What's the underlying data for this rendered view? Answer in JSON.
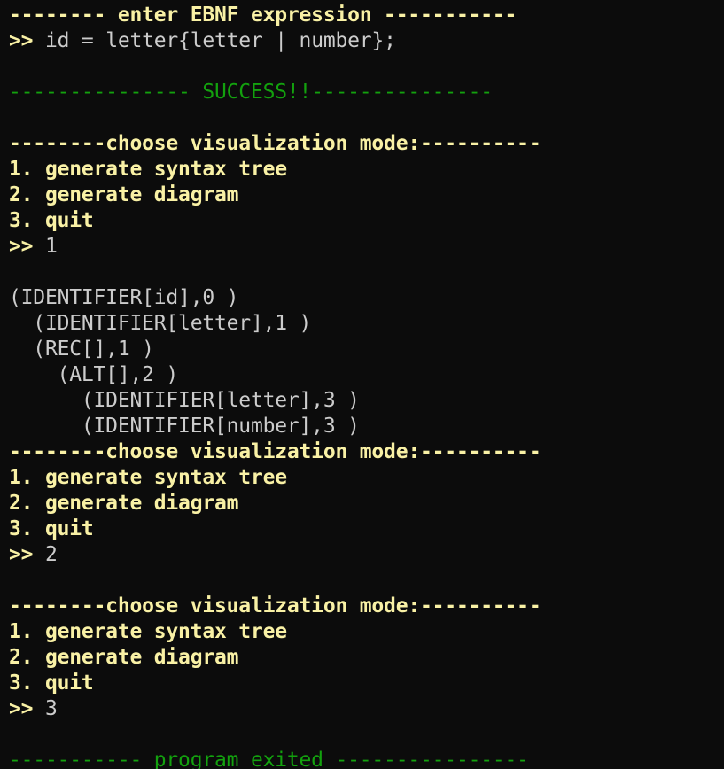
{
  "colors": {
    "background": "#0c0c0c",
    "prompt_text": "#f9f1a5",
    "success_text": "#13a10e",
    "output_text": "#cccccc"
  },
  "header": {
    "enter_expression": "-------- enter EBNF expression -----------"
  },
  "session": {
    "prompt_symbol": ">> ",
    "expression_input": "id = letter{letter | number};",
    "success_message": "--------------- SUCCESS!!---------------",
    "menus": [
      {
        "heading": "--------choose visualization mode:----------",
        "options": [
          "1. generate syntax tree",
          "2. generate diagram",
          "3. quit"
        ],
        "choice": "1"
      },
      {
        "heading": "--------choose visualization mode:----------",
        "options": [
          "1. generate syntax tree",
          "2. generate diagram",
          "3. quit"
        ],
        "choice": "2"
      },
      {
        "heading": "--------choose visualization mode:----------",
        "options": [
          "1. generate syntax tree",
          "2. generate diagram",
          "3. quit"
        ],
        "choice": "3"
      }
    ],
    "syntax_tree": [
      "(IDENTIFIER[id],0 )",
      "  (IDENTIFIER[letter],1 )",
      "  (REC[],1 )",
      "    (ALT[],2 )",
      "      (IDENTIFIER[letter],3 )",
      "      (IDENTIFIER[number],3 )"
    ],
    "exit_message": "----------- program exited ----------------"
  }
}
